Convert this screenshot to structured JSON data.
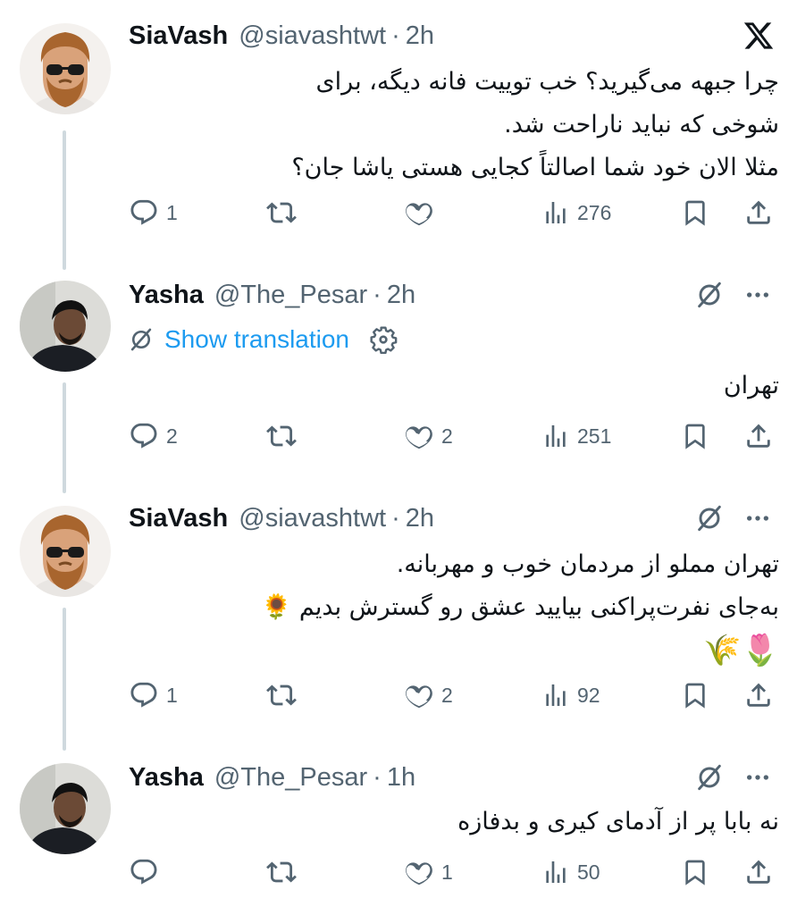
{
  "tweets": [
    {
      "name": "SiaVash",
      "handle": "@siavashtwt",
      "separator": "·",
      "time": "2h",
      "lines": [
        "چرا جبهه می‌گیرید؟ خب توییت فانه دیگه، برای",
        "شوخی که نباید ناراحت شد.",
        "مثلا الان خود شما اصالتاً کجایی هستی یاشا جان؟"
      ],
      "replies": "1",
      "retweets": "",
      "likes": "",
      "views": "276"
    },
    {
      "name": "Yasha",
      "handle": "@The_Pesar",
      "separator": "·",
      "time": "2h",
      "translation_label": "Show translation",
      "lines": [
        "تهران"
      ],
      "replies": "2",
      "retweets": "",
      "likes": "2",
      "views": "251"
    },
    {
      "name": "SiaVash",
      "handle": "@siavashtwt",
      "separator": "·",
      "time": "2h",
      "lines": [
        "تهران مملو از مردمان خوب و مهربانه.",
        "به‌جای نفرت‌پراکنی بیایید عشق رو گسترش بدیم 🌻",
        "🌷🌾"
      ],
      "replies": "1",
      "retweets": "",
      "likes": "2",
      "views": "92"
    },
    {
      "name": "Yasha",
      "handle": "@The_Pesar",
      "separator": "·",
      "time": "1h",
      "lines": [
        "نه بابا پر از آدمای کیری و بدفازه"
      ],
      "replies": "",
      "retweets": "",
      "likes": "1",
      "views": "50"
    }
  ],
  "icons": {
    "brand": "x-logo-icon",
    "reply": "reply-icon",
    "retweet": "retweet-icon",
    "like": "heart-icon",
    "views": "views-icon",
    "bookmark": "bookmark-icon",
    "share": "share-icon",
    "grok": "grok-icon",
    "more": "more-icon",
    "settings": "gear-icon"
  },
  "colors": {
    "text": "#0f1419",
    "secondary": "#536471",
    "link": "#1d9bf0",
    "thread": "#cfd9de"
  }
}
